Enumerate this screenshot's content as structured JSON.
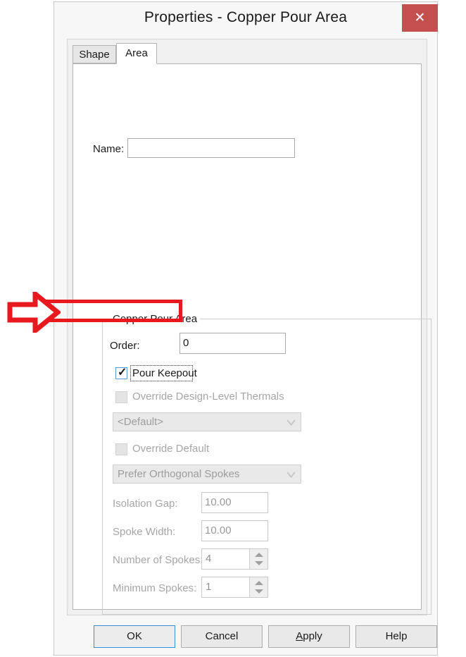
{
  "dialog": {
    "title": "Properties - Copper Pour Area",
    "close_label": "✕",
    "accent_close_color": "#c3504e"
  },
  "tabs": [
    {
      "label": "Shape",
      "active": false
    },
    {
      "label": "Area",
      "active": true
    }
  ],
  "form": {
    "name_label": "Name:",
    "name_value": ""
  },
  "group": {
    "legend": "Copper Pour Area",
    "order_label": "Order:",
    "order_value": "0",
    "pour_keepout_label": "Pour Keepout",
    "pour_keepout_checked": true,
    "override_thermals_label": "Override Design-Level Thermals",
    "override_thermals_checked": false,
    "thermals_combo_value": "<Default>",
    "override_default_label": "Override Default",
    "override_default_checked": false,
    "spokes_combo_value": "Prefer Orthogonal Spokes",
    "isolation_gap_label": "Isolation Gap:",
    "isolation_gap_value": "10.00",
    "spoke_width_label": "Spoke Width:",
    "spoke_width_value": "10.00",
    "number_of_spokes_label": "Number of Spokes:",
    "number_of_spokes_value": "4",
    "minimum_spokes_label": "Minimum Spokes:",
    "minimum_spokes_value": "1"
  },
  "buttons": {
    "ok": "OK",
    "cancel": "Cancel",
    "apply_pre": "",
    "apply_mnemonic": "A",
    "apply_post": "pply",
    "help": "Help"
  },
  "annotation": {
    "highlight_color": "#e8191e",
    "arrow_direction": "right",
    "target": "Pour Keepout"
  }
}
